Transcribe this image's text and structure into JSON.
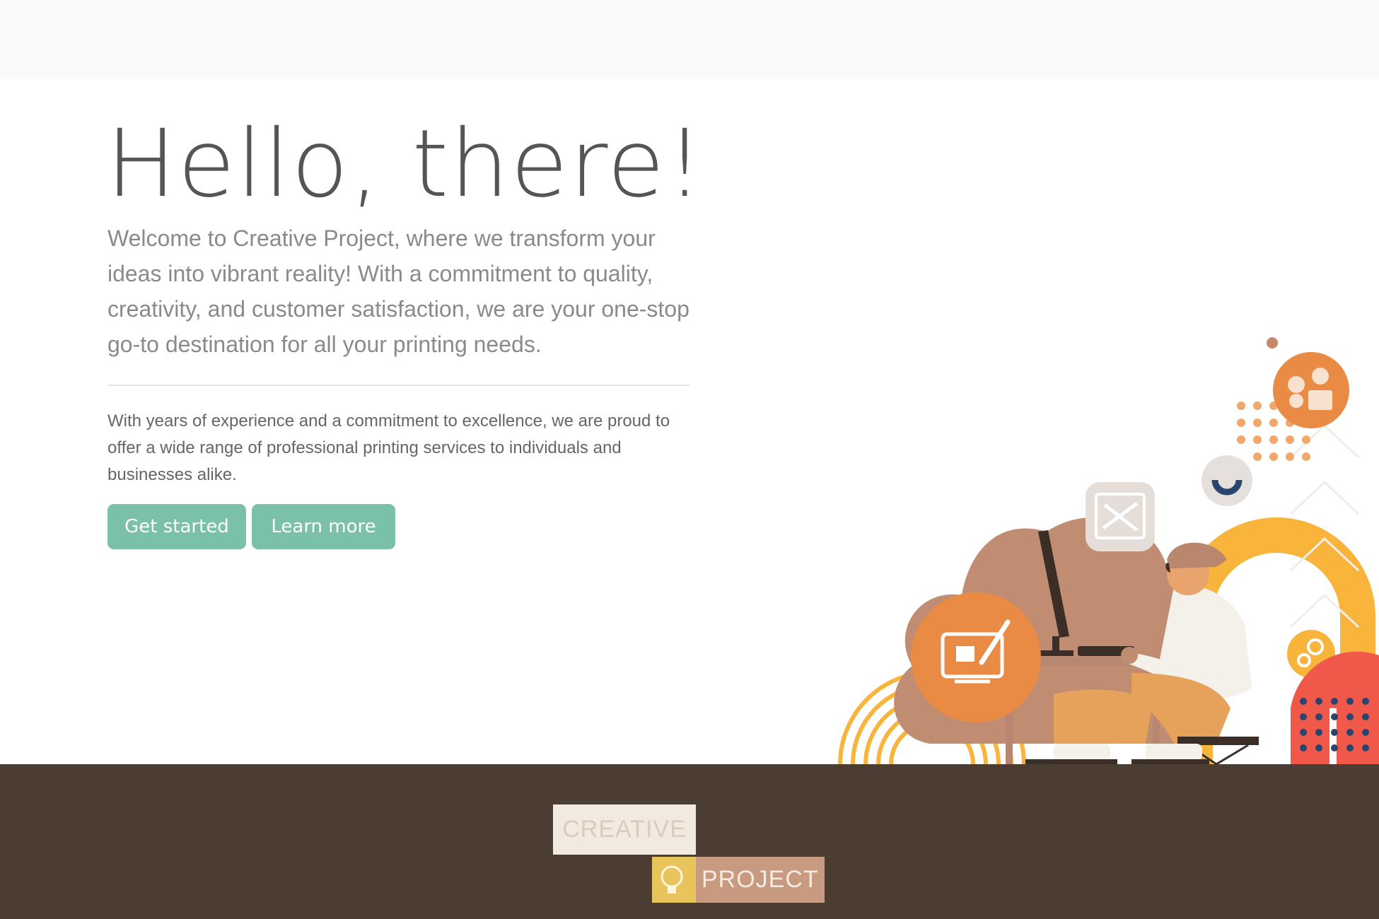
{
  "hero": {
    "title": "Hello, there!",
    "lead": "Welcome to Creative Project, where we transform your ideas into vibrant reality! With a commitment to quality, creativity, and customer satisfaction, we are your one-stop go-to destination for all your printing needs.",
    "body": "With years of experience and a commitment to excellence, we are proud to offer a wide range of professional printing services to individuals and businesses alike.",
    "buttons": {
      "get_started": "Get started",
      "learn_more": "Learn more"
    }
  },
  "footer": {
    "logo_line1": "CREATIVE",
    "logo_line2": "PROJECT"
  },
  "colors": {
    "accent": "#7bc0a8",
    "footer": "#4c3d32",
    "title": "#555555"
  },
  "icons": [
    "designer-illustration",
    "design-tools-icon",
    "paint-screen-icon",
    "ideas-gears-icon",
    "gears-icon"
  ]
}
